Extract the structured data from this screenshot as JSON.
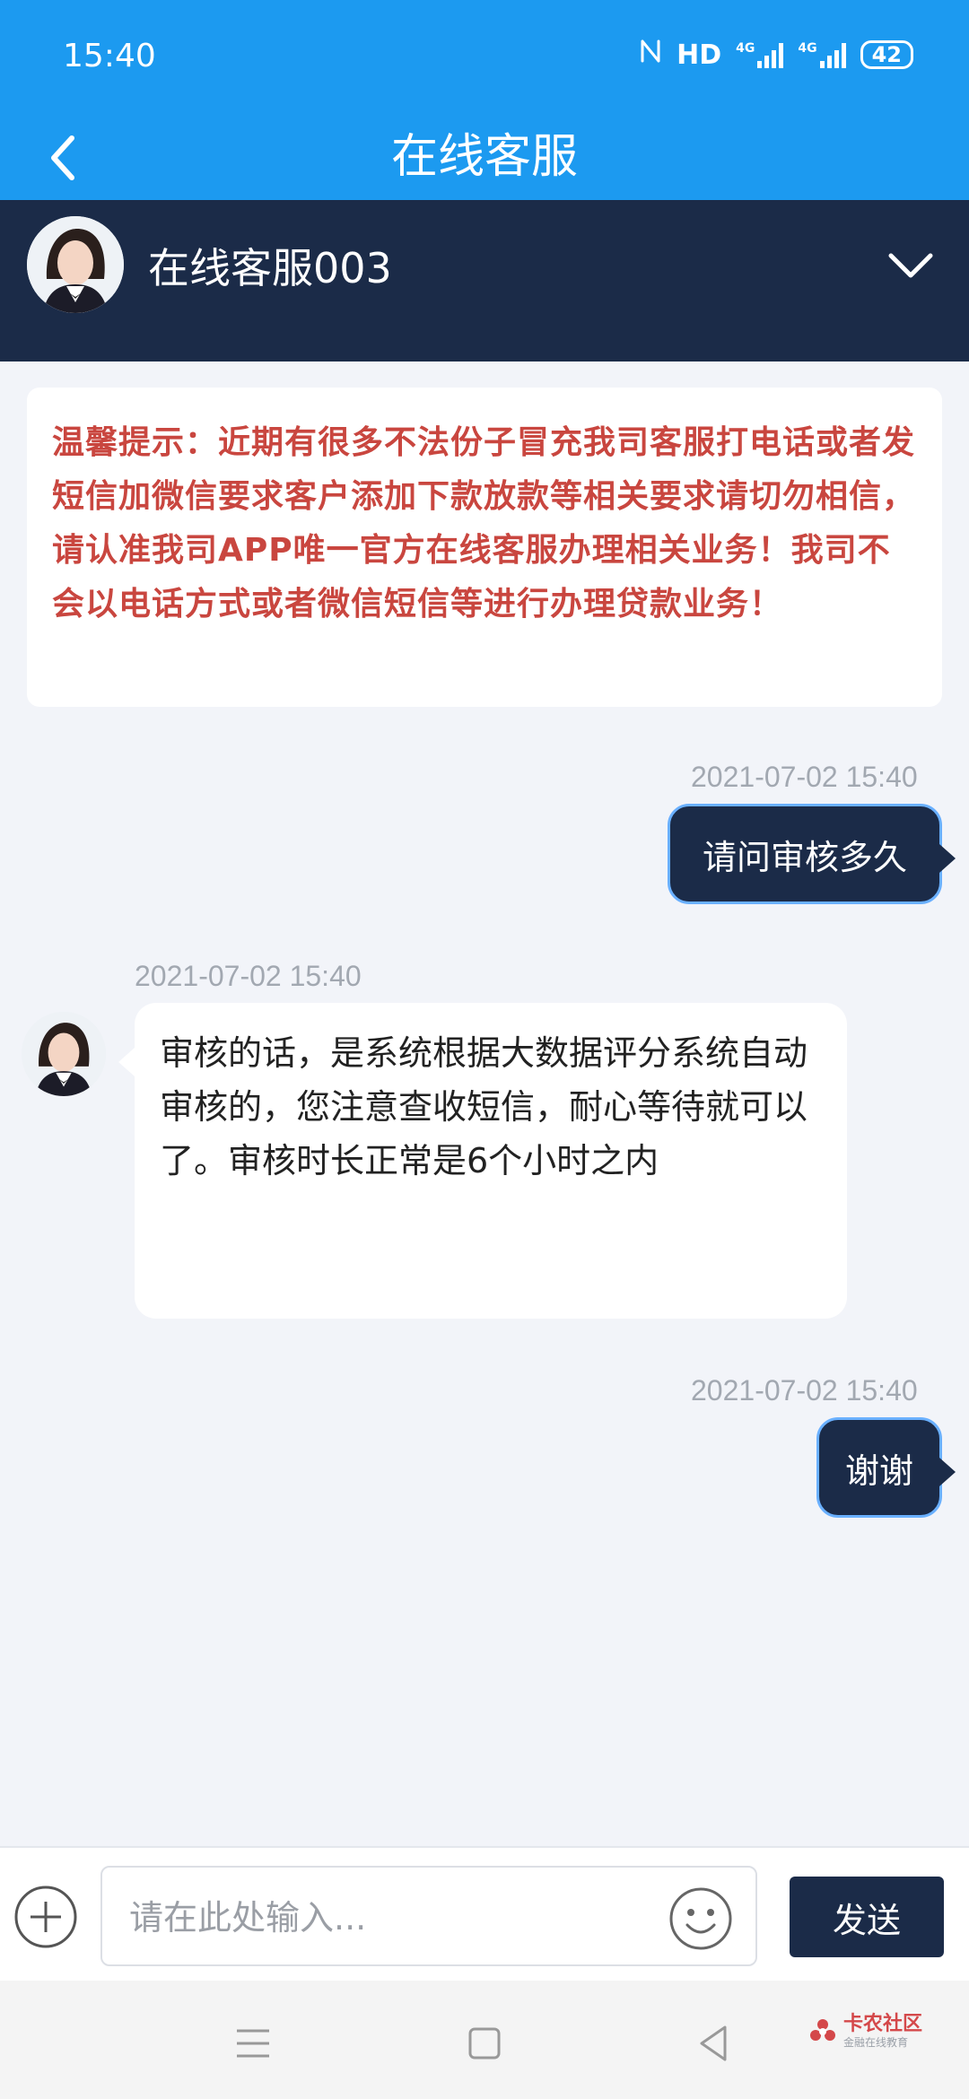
{
  "status_bar": {
    "time": "15:40",
    "hd_label": "HD",
    "network_label_1": "4G",
    "network_label_2": "4G",
    "battery": "42"
  },
  "header": {
    "title": "在线客服"
  },
  "agent": {
    "name": "在线客服003"
  },
  "notice": {
    "text": "温馨提示：近期有很多不法份子冒充我司客服打电话或者发短信加微信要求客户添加下款放款等相关要求请切勿相信，请认准我司APP唯一官方在线客服办理相关业务！我司不会以电话方式或者微信短信等进行办理贷款业务！"
  },
  "messages": [
    {
      "from": "user",
      "time": "2021-07-02 15:40",
      "text": "请问审核多久"
    },
    {
      "from": "agent",
      "time": "2021-07-02 15:40",
      "text": "审核的话，是系统根据大数据评分系统自动审核的，您注意查收短信，耐心等待就可以了。审核时长正常是6个小时之内"
    },
    {
      "from": "user",
      "time": "2021-07-02 15:40",
      "text": "谢谢"
    }
  ],
  "input": {
    "placeholder": "请在此处输入...",
    "value": "",
    "send_label": "发送"
  },
  "watermark": {
    "main": "卡农社区",
    "sub": "金融在线教育"
  },
  "colors": {
    "brand_blue": "#1c9af0",
    "navy": "#1b2b48",
    "notice_red": "#c9463f",
    "background": "#f2f4f9"
  },
  "icons": {
    "back": "chevron-left-icon",
    "expand": "chevron-down-icon",
    "plus": "plus-circle-icon",
    "emoji": "smiley-icon",
    "nav_menu": "menu-icon",
    "nav_home": "square-icon",
    "nav_back": "triangle-back-icon"
  }
}
